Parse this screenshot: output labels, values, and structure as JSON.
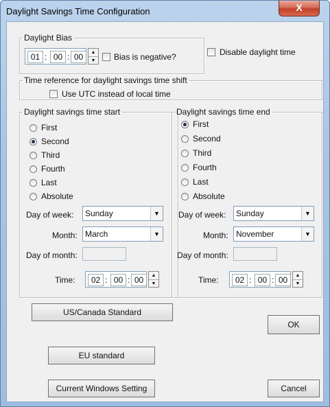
{
  "window": {
    "title": "Daylight Savings Time Configuration",
    "close_label": "X"
  },
  "bias": {
    "legend": "Daylight Bias",
    "hours": "01",
    "minutes": "00",
    "seconds": "00",
    "separator": ":",
    "negative_label": "Bias is negative?",
    "negative_checked": false
  },
  "disable": {
    "label": "Disable daylight time",
    "checked": false
  },
  "time_ref": {
    "legend": "Time reference for daylight savings time shift",
    "utc_label": "Use UTC instead of local time",
    "utc_checked": false
  },
  "start": {
    "legend": "Daylight savings time start",
    "options": [
      "First",
      "Second",
      "Third",
      "Fourth",
      "Last",
      "Absolute"
    ],
    "selected": "Second",
    "day_of_week_label": "Day of week:",
    "day_of_week": "Sunday",
    "month_label": "Month:",
    "month": "March",
    "day_of_month_label": "Day of month:",
    "time_label": "Time:",
    "hours": "02",
    "minutes": "00",
    "seconds": "00"
  },
  "end": {
    "legend": "Daylight savings time end",
    "options": [
      "First",
      "Second",
      "Third",
      "Fourth",
      "Last",
      "Absolute"
    ],
    "selected": "First",
    "day_of_week_label": "Day of week:",
    "day_of_week": "Sunday",
    "month_label": "Month:",
    "month": "November",
    "day_of_month_label": "Day of month:",
    "time_label": "Time:",
    "hours": "02",
    "minutes": "00",
    "seconds": "00"
  },
  "buttons": {
    "us_canada": "US/Canada Standard",
    "eu": "EU standard",
    "current_windows": "Current Windows Setting",
    "ok": "OK",
    "cancel": "Cancel"
  }
}
